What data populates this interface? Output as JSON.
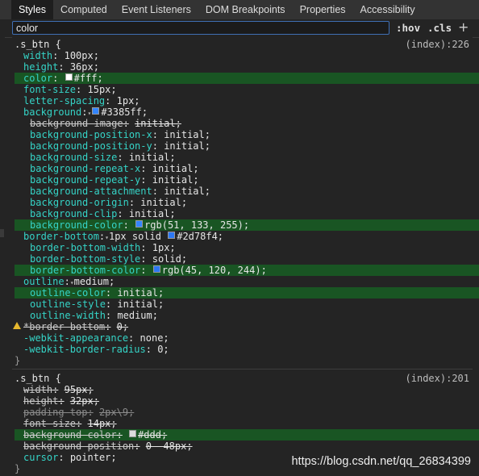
{
  "tabs": [
    "Styles",
    "Computed",
    "Event Listeners",
    "DOM Breakpoints",
    "Properties",
    "Accessibility"
  ],
  "filter": {
    "value": "color",
    "hov": ":hov",
    "cls": ".cls",
    "plus": "+"
  },
  "colors": {
    "highlight": "#195523",
    "property": "#35d4c7",
    "swatch_fff": "#ffffff",
    "swatch_3385ff": "#3385ff",
    "swatch_2d78f4": "#2d78f4",
    "swatch_ddd": "#dddddd",
    "warning": "#e6b82e"
  },
  "rules": [
    {
      "selector": ".s_btn {",
      "source": "(index):226",
      "close": "}",
      "lines": [
        {
          "prop": "width",
          "value": "100px;"
        },
        {
          "prop": "height",
          "value": "36px;"
        },
        {
          "prop": "color",
          "value": "#fff;",
          "swatch": "swatch_fff",
          "highlight": true
        },
        {
          "prop": "font-size",
          "value": "15px;"
        },
        {
          "prop": "letter-spacing",
          "value": "1px;"
        },
        {
          "prop": "background",
          "value": "#3385ff;",
          "swatch": "swatch_3385ff",
          "expander": true
        },
        {
          "prop": "background-image",
          "value": "initial;",
          "indent": true,
          "struck": true
        },
        {
          "prop": "background-position-x",
          "value": "initial;",
          "indent": true
        },
        {
          "prop": "background-position-y",
          "value": "initial;",
          "indent": true
        },
        {
          "prop": "background-size",
          "value": "initial;",
          "indent": true
        },
        {
          "prop": "background-repeat-x",
          "value": "initial;",
          "indent": true
        },
        {
          "prop": "background-repeat-y",
          "value": "initial;",
          "indent": true
        },
        {
          "prop": "background-attachment",
          "value": "initial;",
          "indent": true
        },
        {
          "prop": "background-origin",
          "value": "initial;",
          "indent": true
        },
        {
          "prop": "background-clip",
          "value": "initial;",
          "indent": true
        },
        {
          "prop": "background-color",
          "value": "rgb(51, 133, 255);",
          "swatch": "swatch_3385ff",
          "indent": true,
          "highlight": true
        },
        {
          "prop": "border-bottom",
          "value": "1px solid #2d78f4;",
          "expander": true,
          "swatch_after": "swatch_2d78f4",
          "value_pre": "1px solid ",
          "value_post": "#2d78f4;"
        },
        {
          "prop": "border-bottom-width",
          "value": "1px;",
          "indent": true
        },
        {
          "prop": "border-bottom-style",
          "value": "solid;",
          "indent": true
        },
        {
          "prop": "border-bottom-color",
          "value": "rgb(45, 120, 244);",
          "swatch": "swatch_2d78f4",
          "indent": true,
          "highlight": true
        },
        {
          "prop": "outline",
          "value": "medium;",
          "expander": true
        },
        {
          "prop": "outline-color",
          "value": "initial;",
          "indent": true,
          "highlight": true
        },
        {
          "prop": "outline-style",
          "value": "initial;",
          "indent": true
        },
        {
          "prop": "outline-width",
          "value": "medium;",
          "indent": true
        },
        {
          "prop": "*border-bottom",
          "value": "0;",
          "struck": true,
          "warning": true
        },
        {
          "prop": "-webkit-appearance",
          "value": "none;"
        },
        {
          "prop": "-webkit-border-radius",
          "value": "0;"
        }
      ]
    },
    {
      "selector": ".s_btn {",
      "source": "(index):201",
      "close": "}",
      "lines": [
        {
          "prop": "width",
          "value": "95px;",
          "struck": true
        },
        {
          "prop": "height",
          "value": "32px;",
          "struck": true
        },
        {
          "prop": "padding-top",
          "value": "2px\\9;",
          "dim": true
        },
        {
          "prop": "font-size",
          "value": "14px;",
          "struck": true
        },
        {
          "prop": "background-color",
          "value": "#ddd;",
          "swatch": "swatch_ddd",
          "struck": true,
          "highlight": true
        },
        {
          "prop": "background-position",
          "value": "0 -48px;",
          "struck": true
        },
        {
          "prop": "cursor",
          "value": "pointer;"
        }
      ]
    }
  ],
  "watermark": "https://blog.csdn.net/qq_26834399"
}
